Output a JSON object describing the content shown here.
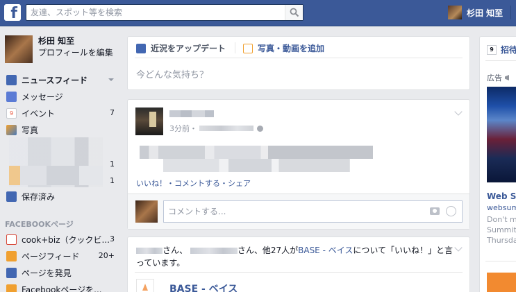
{
  "topbar": {
    "logo": "f",
    "search_placeholder": "友達、スポット等を検索",
    "user_name": "杉田 知至"
  },
  "profile": {
    "name": "杉田 知至",
    "edit_label": "プロフィールを編集"
  },
  "nav": {
    "items": [
      {
        "label": "ニュースフィード",
        "count": "",
        "icon": "newsfeed-icon",
        "color": "#4267b2"
      },
      {
        "label": "メッセージ",
        "count": "",
        "icon": "messages-icon",
        "color": "#5b7bd5"
      },
      {
        "label": "イベント",
        "count": "7",
        "icon": "events-icon",
        "color": "#e9573f"
      },
      {
        "label": "写真",
        "count": "",
        "icon": "photos-icon",
        "color": "#f0a030"
      }
    ],
    "blurred_counts": [
      "1",
      "1"
    ],
    "saved_label": "保存済み"
  },
  "pages_section": {
    "title": "FACEBOOKページ",
    "items": [
      {
        "label": "cook+biz（クックビ...",
        "count": "3",
        "icon": "cookbiz-icon",
        "color": "#d94c3d"
      },
      {
        "label": "ページフィード",
        "count": "20+",
        "icon": "pages-feed-icon",
        "color": "#f0a030"
      },
      {
        "label": "ページを発見",
        "count": "",
        "icon": "discover-pages-icon",
        "color": "#4267b2"
      },
      {
        "label": "Facebookページを...",
        "count": "",
        "icon": "create-page-icon",
        "color": "#f0a030"
      }
    ]
  },
  "composer": {
    "status_tab": "近況をアップデート",
    "photo_tab": "写真・動画を追加",
    "prompt": "今どんな気持ち？"
  },
  "post": {
    "time": "3分前・",
    "actions": "いいね！・コメントする・シェア",
    "comment_placeholder": "コメントする..."
  },
  "story": {
    "san1": "さん、",
    "san2": "さん、他27人が",
    "page_name": "BASE - ベイス",
    "suffix": "について「いいね！」と言っています。",
    "title": "BASE - ベイス"
  },
  "right": {
    "invite_label": "招待",
    "ad_label": "広告",
    "ad_title": "Web Su",
    "ad_url": "websum",
    "ad_desc": [
      "Don't mi",
      "Summit",
      "Thursda"
    ]
  }
}
